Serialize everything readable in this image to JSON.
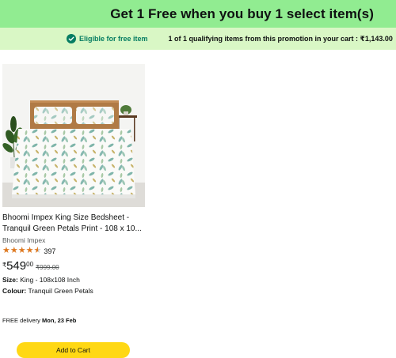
{
  "promo": {
    "title": "Get 1 Free when you buy 1 select item(s)",
    "eligible_label": "Eligible for free item",
    "qualifying_text": "1 of 1 qualifying items from this promotion in your cart : ₹1,143.00",
    "check_icon": "check-circle-icon",
    "header_color": "#91ec91",
    "sub_color": "#d9f7c5"
  },
  "product": {
    "title": "Bhoomi Impex King Size Bedsheet - Tranquil Green Petals Print - 108 x 10...",
    "brand": "Bhoomi Impex",
    "rating_value": 4.5,
    "rating_count": "397",
    "price": {
      "currency": "₹",
      "whole": "549",
      "fraction": "00",
      "mrp": "₹999.00"
    },
    "specs": [
      {
        "key": "Size:",
        "value": "King - 108x108 Inch"
      },
      {
        "key": "Colour:",
        "value": "Tranquil Green Petals"
      }
    ],
    "delivery": {
      "prefix": "FREE delivery",
      "date": "Mon, 23 Feb"
    },
    "cart_label": "Add to Cart",
    "cart_color": "#ffd814"
  }
}
